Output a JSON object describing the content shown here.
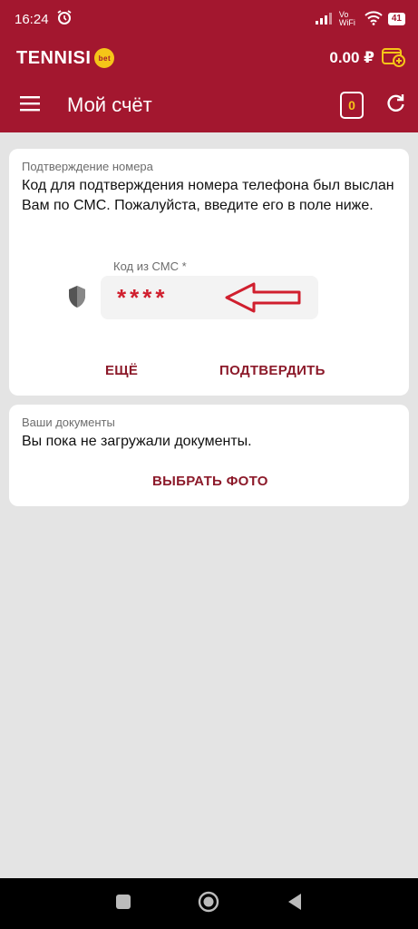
{
  "status": {
    "time": "16:24",
    "network": "Vo WiFi",
    "battery": "41"
  },
  "brand": {
    "logo": "TENNISI",
    "badge": "bet",
    "balance": "0.00 ₽"
  },
  "toolbar": {
    "title": "Мой счёт",
    "coupon_count": "0"
  },
  "phone_confirm": {
    "label": "Подтверждение номера",
    "text": "Код для подтверждения номера телефона был выслан Вам по СМС. Пожалуйста, введите его в поле ниже.",
    "field_label": "Код из СМС *",
    "field_value": "****",
    "more_button": "ЕЩЁ",
    "confirm_button": "ПОДТВЕРДИТЬ"
  },
  "documents": {
    "label": "Ваши документы",
    "text": "Вы пока не загружали документы.",
    "select_photo_button": "ВЫБРАТЬ ФОТО"
  },
  "colors": {
    "primary": "#a3172f",
    "accent_text": "#8c1a2a",
    "code_red": "#d01f2e",
    "badge_yellow": "#f5c518"
  },
  "icons": [
    "alarm-icon",
    "signal-icon",
    "wifi-icon",
    "battery-icon",
    "wallet-add-icon",
    "menu-icon",
    "coupon-icon",
    "refresh-icon",
    "shield-icon",
    "arrow-left-icon",
    "nav-square-icon",
    "nav-circle-icon",
    "nav-back-icon"
  ]
}
